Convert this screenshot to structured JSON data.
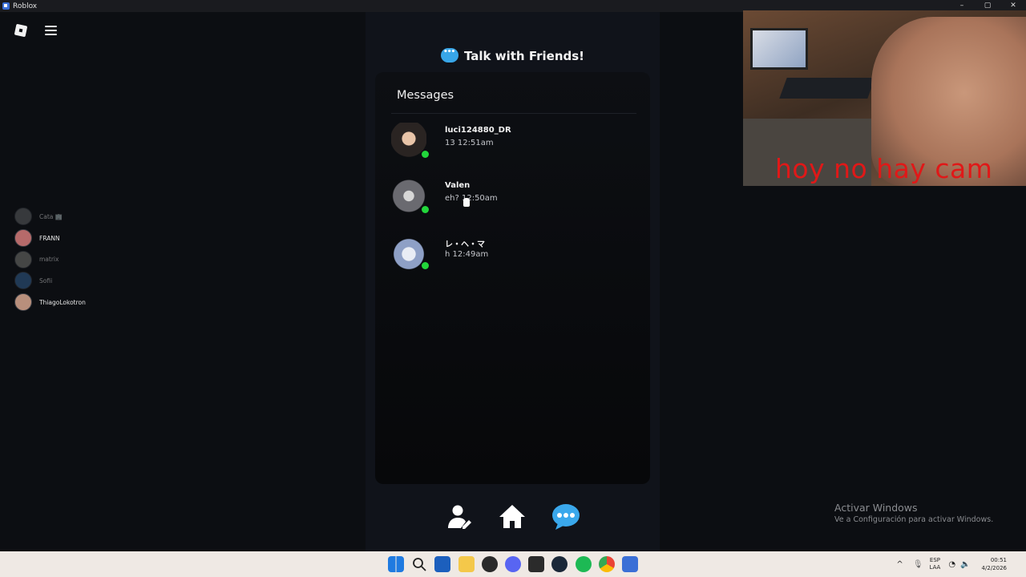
{
  "window": {
    "title": "Roblox",
    "controls": [
      "–",
      "▢",
      "✕"
    ]
  },
  "sidebar": {
    "friends": [
      {
        "name": "Cata 🏢",
        "color": "#6b6e70",
        "dim": true
      },
      {
        "name": "FRANN",
        "color": "#b66a6a",
        "dim": false
      },
      {
        "name": "matrix",
        "color": "#8a8a84",
        "dim": true
      },
      {
        "name": "Sofii",
        "color": "#3a6fa8",
        "dim": true
      },
      {
        "name": "ThiagoLokotron",
        "color": "#b88f7c",
        "dim": false
      }
    ]
  },
  "header": {
    "title": "Talk with Friends!",
    "icon": "chat-bubble-icon"
  },
  "messages": {
    "title": "Messages",
    "conversations": [
      {
        "name": "luci124880_DR",
        "preview": "13 12:51am",
        "online": true,
        "avatar_color": "#3b2a26"
      },
      {
        "name": "Valen",
        "preview": "eh? 12:50am",
        "online": true,
        "avatar_color": "#8f8f94"
      },
      {
        "name": "レ・ヘ・マ",
        "preview": "h 12:49am",
        "online": true,
        "avatar_color": "#a8b4cc"
      }
    ]
  },
  "bottom_nav": {
    "items": [
      {
        "icon": "profile-edit-icon"
      },
      {
        "icon": "home-icon"
      },
      {
        "icon": "chat-bubble-icon",
        "active": true
      }
    ]
  },
  "webcam": {
    "caption": "hoy no hay cam"
  },
  "watermark": {
    "line1": "Activar Windows",
    "line2": "Ve a Configuración para activar Windows."
  },
  "taskbar": {
    "icons": [
      "windows-start-icon",
      "search-icon",
      "store-icon",
      "file-explorer-icon",
      "app-icon",
      "discord-icon",
      "epic-games-icon",
      "steam-icon",
      "spotify-icon",
      "chrome-icon",
      "roblox-icon"
    ],
    "lang_top": "ESP",
    "lang_bottom": "LAA",
    "time": "00:51",
    "date": "4/2/2026"
  }
}
